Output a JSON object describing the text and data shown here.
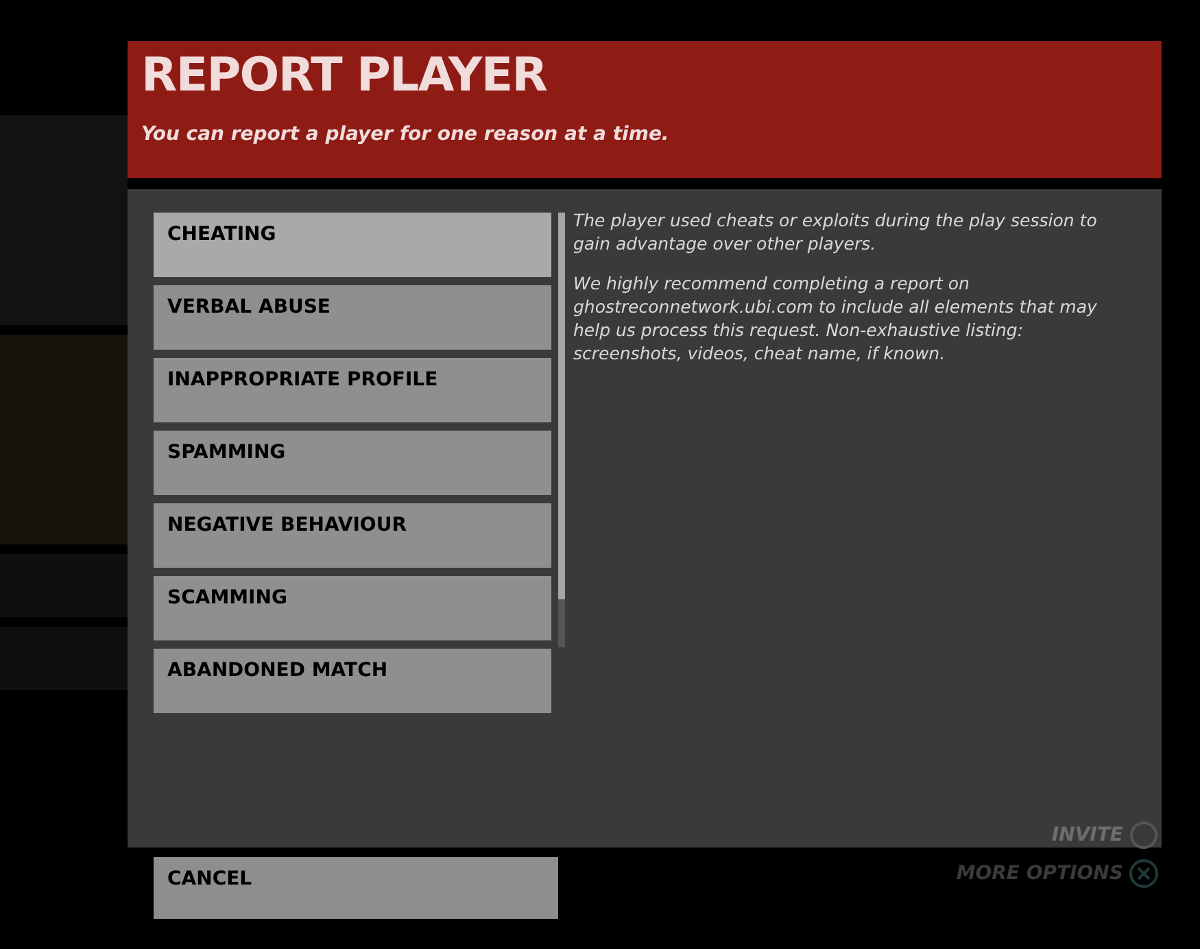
{
  "dialog": {
    "title": "REPORT PLAYER",
    "subtitle": "You can report a player for one reason at a time."
  },
  "reasons": [
    {
      "label": "CHEATING",
      "selected": true
    },
    {
      "label": "VERBAL ABUSE",
      "selected": false
    },
    {
      "label": "INAPPROPRIATE PROFILE",
      "selected": false
    },
    {
      "label": "SPAMMING",
      "selected": false
    },
    {
      "label": "NEGATIVE BEHAVIOUR",
      "selected": false
    },
    {
      "label": "SCAMMING",
      "selected": false
    },
    {
      "label": "ABANDONED MATCH",
      "selected": false
    }
  ],
  "description": [
    "The player used cheats or exploits during the play session to gain advantage over other players.",
    "We highly recommend completing a report on ghostreconnetwork.ubi.com to include all elements that may help us process this request. Non-exhaustive listing: screenshots, videos, cheat name, if known."
  ],
  "cancel_button": "CANCEL",
  "background_actions": [
    "INVITE",
    "MORE OPTIONS"
  ]
}
